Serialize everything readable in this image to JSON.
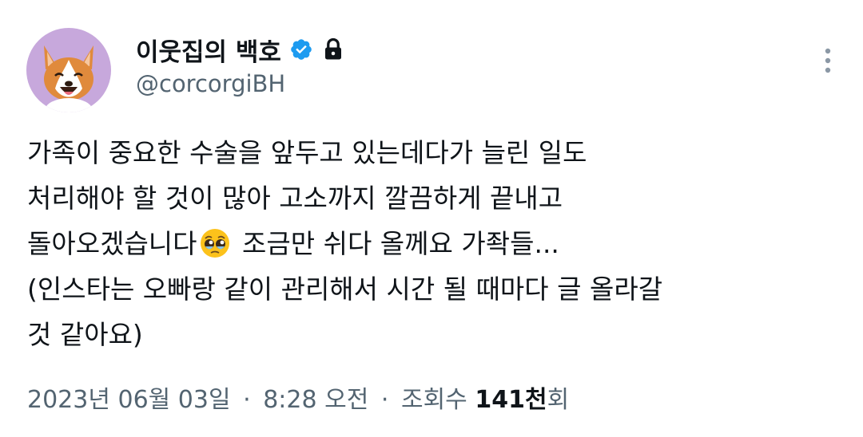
{
  "author": {
    "display_name": "이웃집의 백호",
    "handle": "@corcorgiBH",
    "verified_icon": "verified-badge-icon",
    "lock_icon": "lock-icon",
    "avatar": "corgi-avatar"
  },
  "menu": {
    "icon": "more-vertical-icon"
  },
  "tweet": {
    "lines": [
      "가족이 중요한 수술을 앞두고 있는데다가 늘린 일도",
      "처리해야 할 것이 많아 고소까지 깔끔하게 끝내고",
      "돌아오겠습니다",
      " 조금만 쉬다 올께요 가좍들...",
      "(인스타는 오빠랑 같이 관리해서 시간 될 때마다 글 올라갈",
      "것 같아요)"
    ],
    "emoji": "pleading-face-emoji-icon"
  },
  "meta": {
    "date": "2023년 06월 03일",
    "separator": "·",
    "time": "8:28 오전",
    "views_label": "조회수",
    "views_count": "141천",
    "views_suffix": "회"
  },
  "colors": {
    "text": "#0f1419",
    "secondary": "#536471",
    "verified": "#1d9bf0",
    "avatar_bg": "#c7a8dc",
    "corgi_fur": "#e08a3c"
  }
}
